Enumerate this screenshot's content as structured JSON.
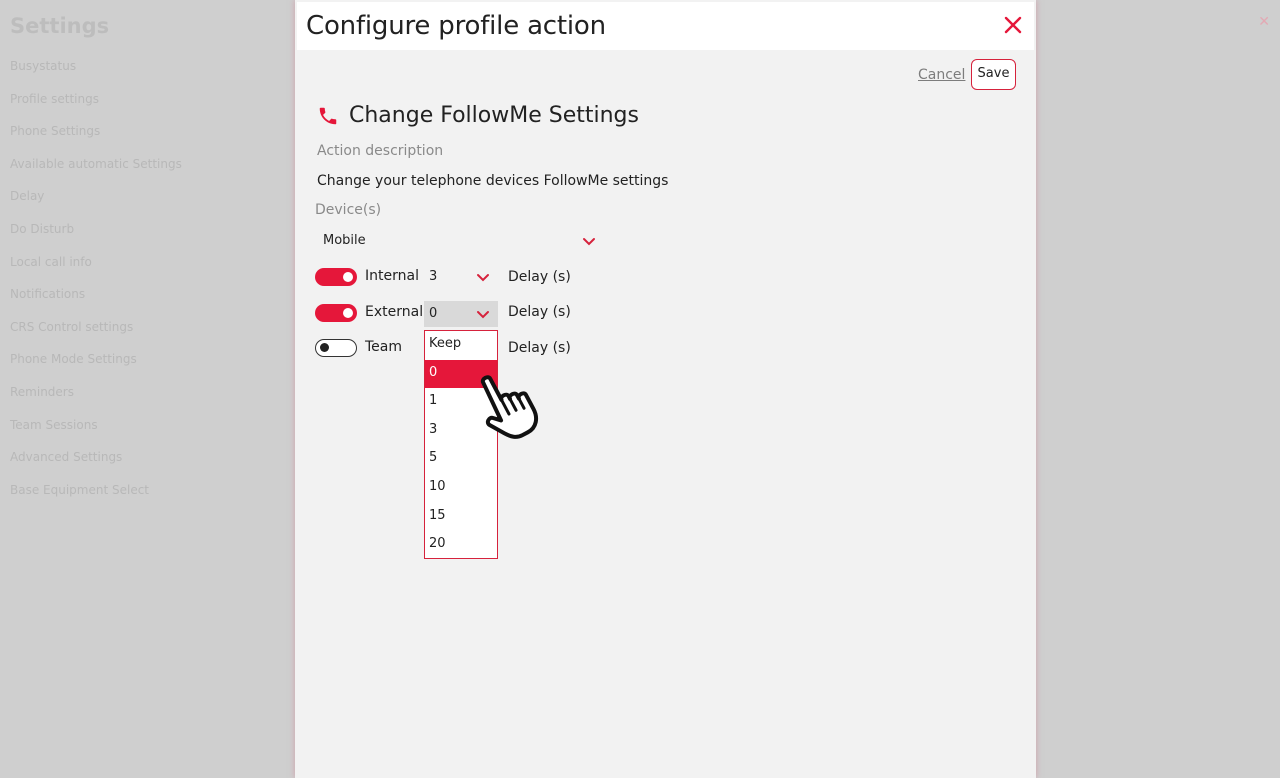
{
  "background": {
    "title": "Settings",
    "menu_items": [
      "Busystatus",
      "Profile settings",
      "Phone Settings",
      "Available automatic Settings",
      "Delay",
      "Do Disturb",
      "Local call info",
      "Notifications",
      "CRS Control settings",
      "Phone Mode Settings",
      "Reminders",
      "Team Sessions",
      "Advanced Settings",
      "Base Equipment Select"
    ]
  },
  "modal": {
    "title": "Configure profile action",
    "cancel_label": "Cancel",
    "save_label": "Save",
    "section_title": "Change FollowMe Settings",
    "action_description_label": "Action description",
    "action_description": "Change your telephone devices FollowMe settings",
    "devices_label": "Device(s)",
    "device_value": "Mobile",
    "rows": [
      {
        "label": "Internal",
        "enabled": true,
        "delay_value": "3",
        "delay_label": "Delay (s)"
      },
      {
        "label": "External",
        "enabled": true,
        "delay_value": "0",
        "delay_label": "Delay (s)"
      },
      {
        "label": "Team",
        "enabled": false,
        "delay_value": "",
        "delay_label": "Delay (s)"
      }
    ],
    "dropdown_options": [
      "Keep",
      "0",
      "1",
      "3",
      "5",
      "10",
      "15",
      "20"
    ],
    "dropdown_selected": "0"
  },
  "colors": {
    "accent": "#e5173a",
    "modal_bg": "#f2f2f2"
  },
  "icons": [
    "close-icon",
    "phone-icon",
    "chevron-down-icon",
    "hand-pointer-cursor-icon"
  ]
}
